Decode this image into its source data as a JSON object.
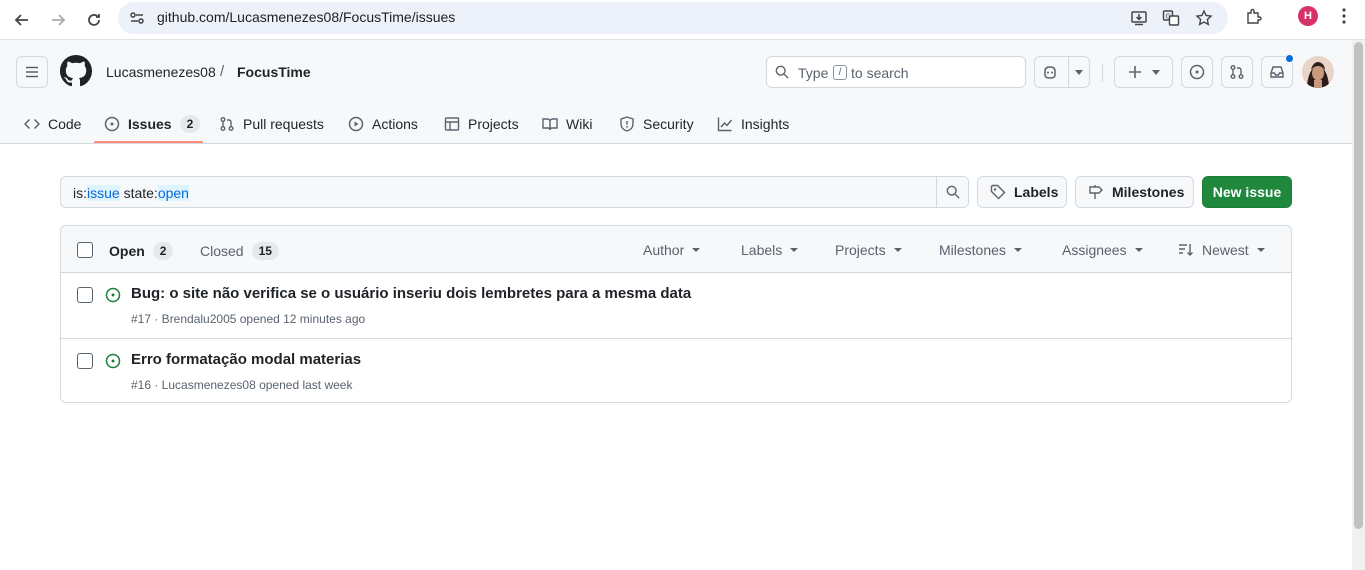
{
  "browser": {
    "url": "github.com/Lucasmenezes08/FocusTime/issues",
    "profile_initial": "H"
  },
  "header": {
    "owner": "Lucasmenezes08",
    "separator": "/",
    "repo": "FocusTime",
    "search": {
      "prefix": "Type",
      "key": "/",
      "suffix": "to search"
    }
  },
  "tabs": [
    {
      "label": "Code"
    },
    {
      "label": "Issues",
      "count": "2"
    },
    {
      "label": "Pull requests"
    },
    {
      "label": "Actions"
    },
    {
      "label": "Projects"
    },
    {
      "label": "Wiki"
    },
    {
      "label": "Security"
    },
    {
      "label": "Insights"
    }
  ],
  "filter": {
    "q_is": "is:",
    "q_issue": "issue",
    "q_state": " state:",
    "q_open": "open",
    "labels_label": "Labels",
    "milestones_label": "Milestones",
    "new_issue_label": "New issue"
  },
  "list": {
    "open_label": "Open",
    "open_count": "2",
    "closed_label": "Closed",
    "closed_count": "15",
    "filters": [
      "Author",
      "Labels",
      "Projects",
      "Milestones",
      "Assignees",
      "Newest"
    ]
  },
  "issues": [
    {
      "title": "Bug: o site não verifica se o usuário inseriu dois lembretes para a mesma data",
      "meta": "#17 · Brendalu2005 opened 12 minutes ago"
    },
    {
      "title": "Erro formatação modal materias",
      "meta": "#16 · Lucasmenezes08 opened last week"
    }
  ],
  "colors": {
    "accent_green": "#1f883d",
    "open_icon": "#1a7f37",
    "tab_underline": "#fd8c73"
  }
}
